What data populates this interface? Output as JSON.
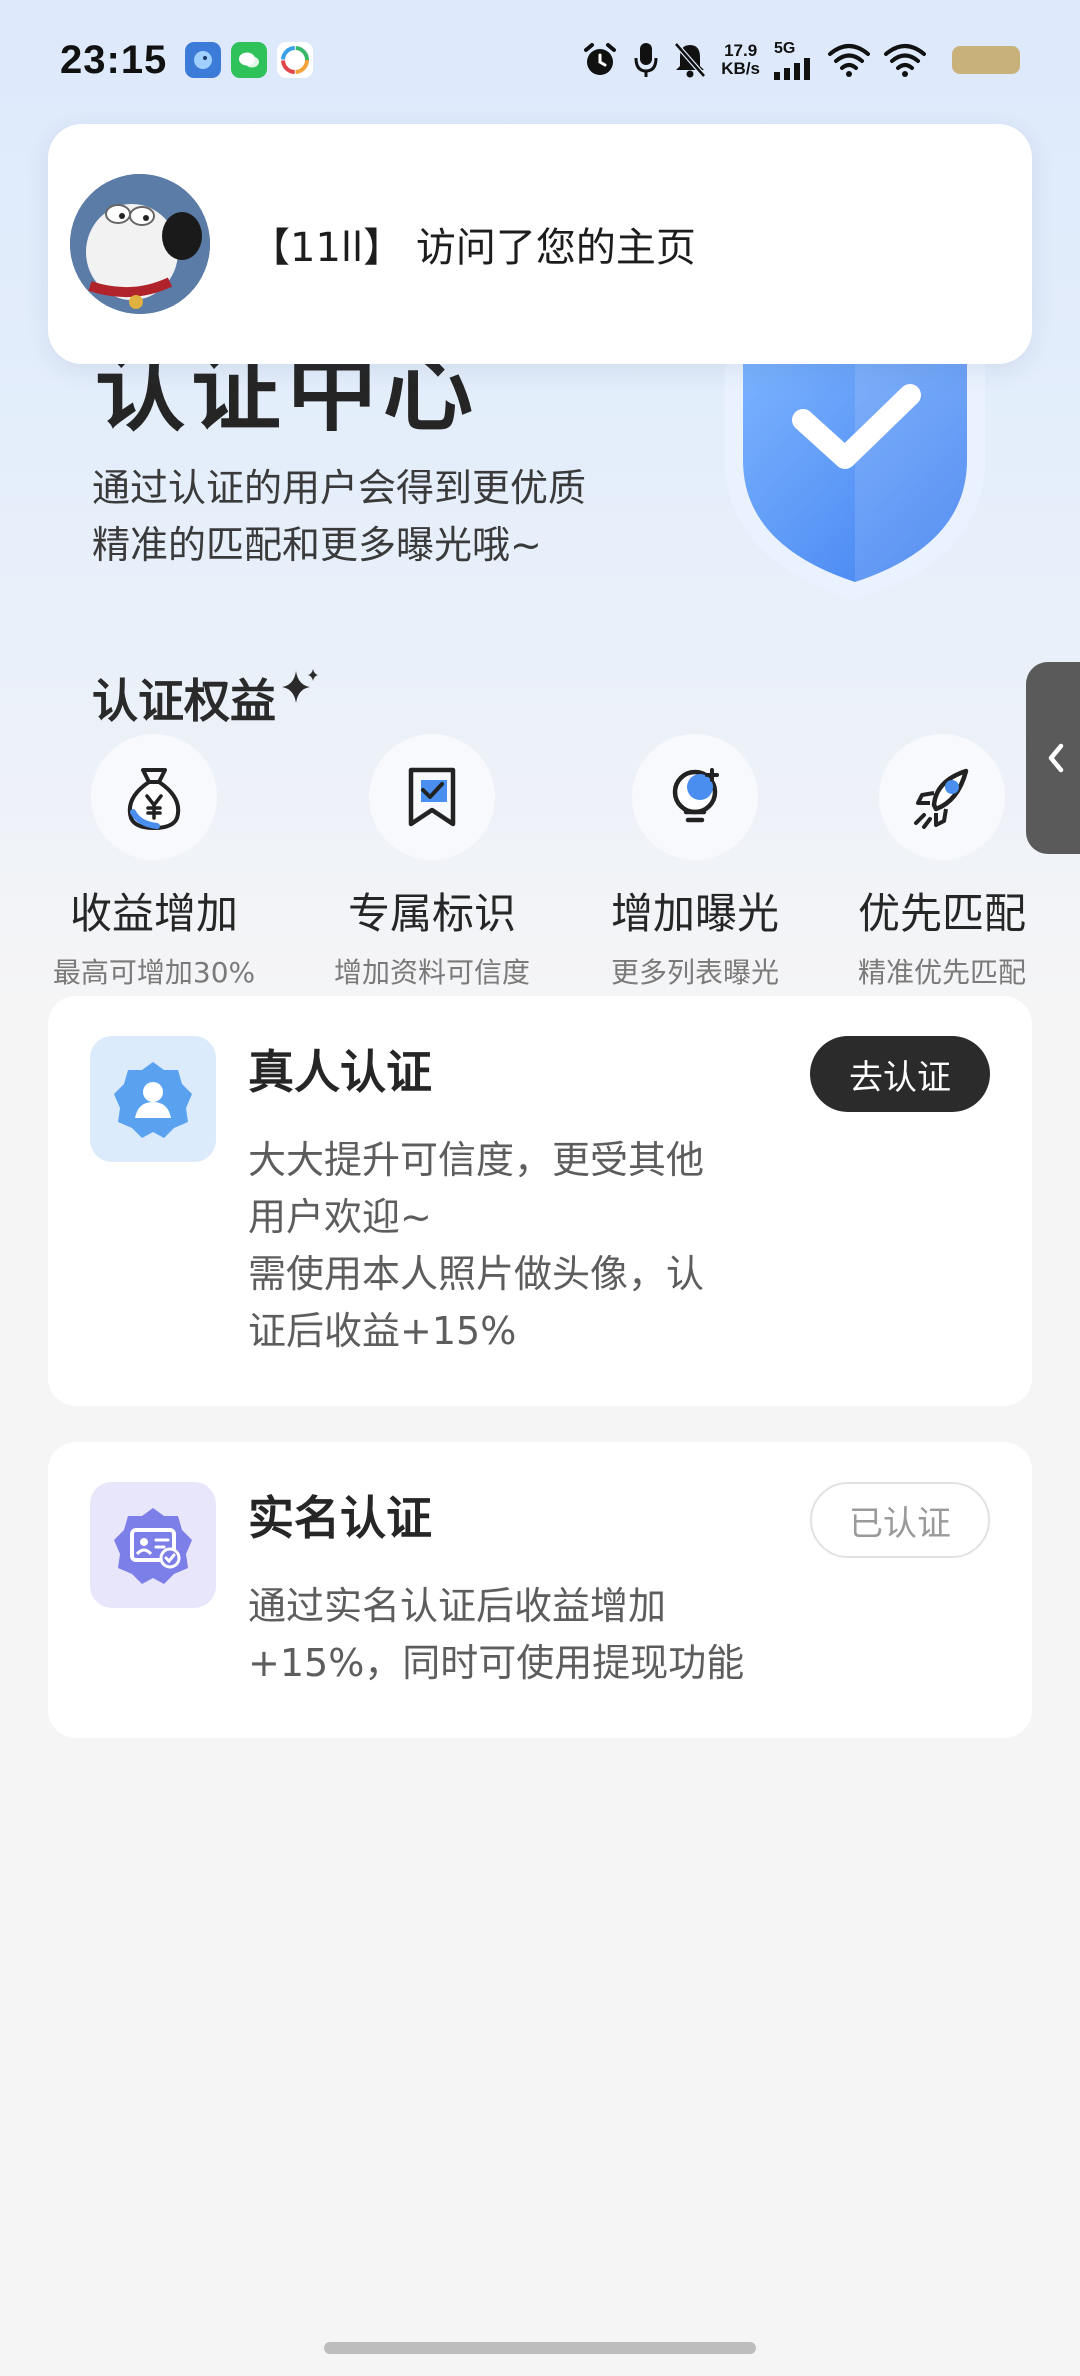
{
  "status_bar": {
    "time": "23:15",
    "net_speed_value": "17.9",
    "net_speed_unit": "KB/s",
    "network": "5G"
  },
  "notification": {
    "text": "【11ll】 访问了您的主页"
  },
  "hero": {
    "title": "认证中心",
    "description_line1": "通过认证的用户会得到更优质",
    "description_line2": "精准的匹配和更多曝光哦~"
  },
  "benefits": {
    "title": "认证权益",
    "items": [
      {
        "icon": "money-bag-icon",
        "title": "收益增加",
        "subtitle": "最高可增加30%"
      },
      {
        "icon": "bookmark-badge-icon",
        "title": "专属标识",
        "subtitle": "增加资料可信度"
      },
      {
        "icon": "lightbulb-icon",
        "title": "增加曝光",
        "subtitle": "更多列表曝光"
      },
      {
        "icon": "rocket-icon",
        "title": "优先匹配",
        "subtitle": "精准优先匹配"
      }
    ]
  },
  "cards": [
    {
      "icon": "person-badge-icon",
      "title": "真人认证",
      "description": [
        "大大提升可信度，更受其他",
        "用户欢迎~",
        "需使用本人照片做头像，认",
        "证后收益+15%"
      ],
      "button": "去认证",
      "status": "pending"
    },
    {
      "icon": "id-card-badge-icon",
      "title": "实名认证",
      "description": [
        "通过实名认证后收益增加",
        "+15%，同时可使用提现功能"
      ],
      "button": "已认证",
      "status": "verified"
    }
  ],
  "colors": {
    "accent_blue": "#4a8ff0",
    "dark_button": "#2b2b2b",
    "card_icon_bg_blue": "#dcebfc",
    "card_icon_bg_purple": "#e7e6fb"
  }
}
